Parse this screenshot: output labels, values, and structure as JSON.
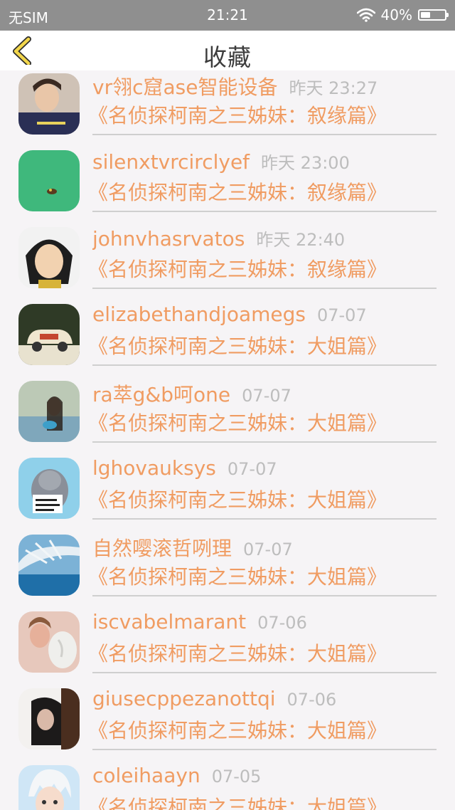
{
  "status_bar": {
    "carrier": "无SIM",
    "time": "21:21",
    "battery": "40%",
    "battery_level": 0.4
  },
  "nav": {
    "back_icon": "chevron-left-icon",
    "title": "收藏"
  },
  "colors": {
    "accent": "#f09c62",
    "muted": "#bdbdbd",
    "status_bar_bg": "#8f8f8f"
  },
  "items": [
    {
      "user": "vr翎c窟ase智能设备",
      "date": "昨天 23:27",
      "title": "《名侦探柯南之三姊妹：叙缘篇》",
      "avatar": "avatar-boy-photo"
    },
    {
      "user": "silenxtvrcirclyef",
      "date": "昨天 23:00",
      "title": "《名侦探柯南之三姊妹：叙缘篇》",
      "avatar": "avatar-green"
    },
    {
      "user": "johnvhasrvatos",
      "date": "昨天 22:40",
      "title": "《名侦探柯南之三姊妹：叙缘篇》",
      "avatar": "avatar-luffy"
    },
    {
      "user": "elizabethandjoamegs",
      "date": "07-07",
      "title": "《名侦探柯南之三姊妹：大姐篇》",
      "avatar": "avatar-toy-car"
    },
    {
      "user": "ra萃g&b呵one",
      "date": "07-07",
      "title": "《名侦探柯南之三姊妹：大姐篇》",
      "avatar": "avatar-woman-water"
    },
    {
      "user": "lghovauksys",
      "date": "07-07",
      "title": "《名侦探柯南之三姊妹：大姐篇》",
      "avatar": "avatar-cat"
    },
    {
      "user": "自然嘤滚哲咧理",
      "date": "07-07",
      "title": "《名侦探柯南之三姊妹：大姐篇》",
      "avatar": "avatar-winter-tree"
    },
    {
      "user": "iscvabelmarant",
      "date": "07-06",
      "title": "《名侦探柯南之三姊妹：大姐篇》",
      "avatar": "avatar-woman-statue"
    },
    {
      "user": "giusecppezanottqi",
      "date": "07-06",
      "title": "《名侦探柯南之三姊妹：大姐篇》",
      "avatar": "avatar-girl-dark"
    },
    {
      "user": "coleihaayn",
      "date": "07-05",
      "title": "《名侦探柯南之三姊妹：大姐篇》",
      "avatar": "avatar-anime-boy"
    }
  ]
}
